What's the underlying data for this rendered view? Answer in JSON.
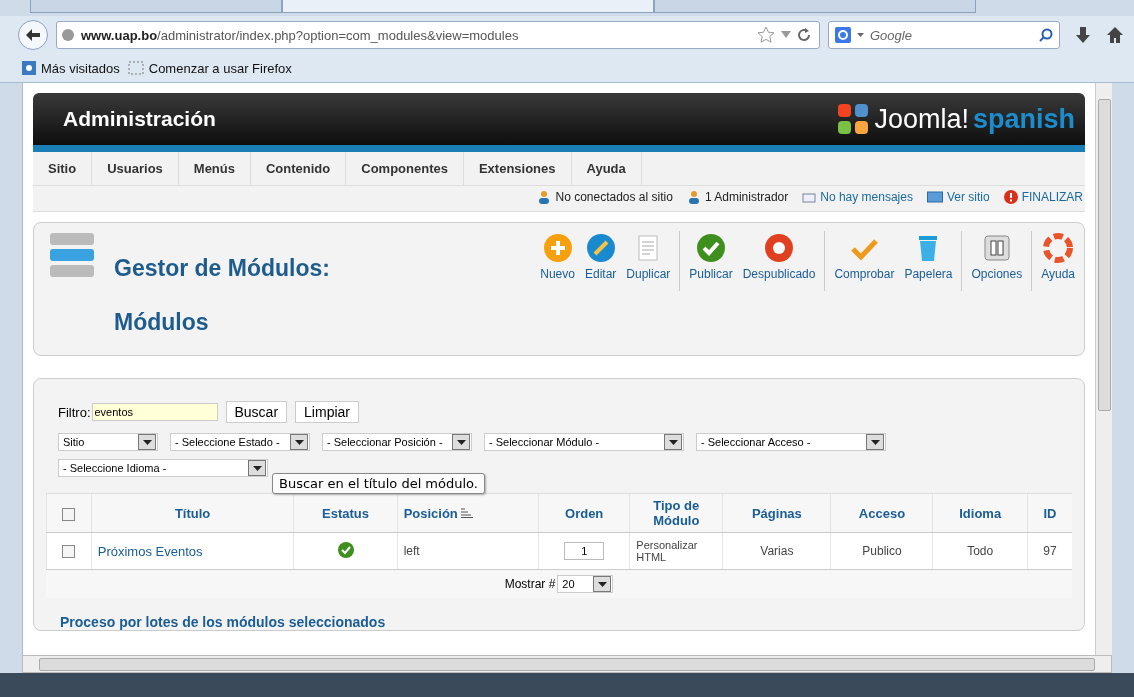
{
  "browser": {
    "tabs": [
      {
        "selected": false
      },
      {
        "selected": true
      },
      {
        "selected": false
      }
    ],
    "url_host": "www.uap.bo",
    "url_path": "/administrator/index.php?option=com_modules&view=modules",
    "search_placeholder": "Google",
    "bookmarks": [
      "Más visitados",
      "Comenzar a usar Firefox"
    ]
  },
  "header": {
    "title": "Administración",
    "logo_text": "Joomla!",
    "logo_suffix": "spanish"
  },
  "menu": [
    "Sitio",
    "Usuarios",
    "Menús",
    "Contenido",
    "Componentes",
    "Extensiones",
    "Ayuda"
  ],
  "status_links": [
    {
      "kind": "users",
      "label": "No conectados al sitio",
      "link": false
    },
    {
      "kind": "admin",
      "label": "1 Administrador",
      "link": false
    },
    {
      "kind": "mail",
      "label": "No hay mensajes",
      "link": true
    },
    {
      "kind": "screen",
      "label": "Ver sitio",
      "link": true
    },
    {
      "kind": "logout",
      "label": "FINALIZAR",
      "link": true
    }
  ],
  "page_title": "Gestor de Módulos: Módulos",
  "toolbar": [
    [
      {
        "kind": "new",
        "label": "Nuevo"
      },
      {
        "kind": "edit",
        "label": "Editar"
      },
      {
        "kind": "copy",
        "label": "Duplicar"
      }
    ],
    [
      {
        "kind": "publish",
        "label": "Publicar"
      },
      {
        "kind": "unpublish",
        "label": "Despublicado"
      }
    ],
    [
      {
        "kind": "checkin",
        "label": "Comprobar"
      },
      {
        "kind": "trash",
        "label": "Papelera"
      }
    ],
    [
      {
        "kind": "options",
        "label": "Opciones"
      }
    ],
    [
      {
        "kind": "help",
        "label": "Ayuda"
      }
    ]
  ],
  "filter": {
    "label": "Filtro:",
    "value": "eventos",
    "buttons": [
      "Buscar",
      "Limpiar"
    ],
    "tooltip": "Buscar en el título del módulo."
  },
  "selects": [
    "Sitio",
    "- Seleccione Estado -",
    "- Seleccionar Posición -",
    "- Seleccionar Módulo -",
    "- Seleccionar Acceso -",
    "- Seleccione Idioma -"
  ],
  "table": {
    "header_checked": false,
    "columns": [
      "Título",
      "Estatus",
      "Posición",
      "Orden",
      "Tipo de Módulo",
      "Páginas",
      "Acceso",
      "Idioma",
      "ID"
    ],
    "rows": [
      {
        "checked": false,
        "title": "Próximos Eventos",
        "published": true,
        "position": "left",
        "order": "1",
        "type": "Personalizar HTML",
        "pages": "Varias",
        "access": "Publico",
        "language": "Todo",
        "id": "97"
      }
    ]
  },
  "pagination": {
    "label": "Mostrar #",
    "value": "20"
  },
  "batch_heading": "Proceso por lotes de los módulos seleccionados"
}
